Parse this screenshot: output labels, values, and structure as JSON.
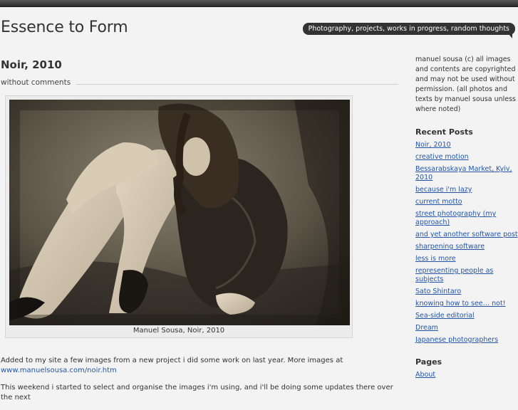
{
  "header": {
    "site_title": "Essence to Form",
    "tagline": "Photography, projects, works in progress, random thoughts"
  },
  "post": {
    "title": "Noir, 2010",
    "comments": "without comments",
    "caption": "Manuel Sousa, Noir, 2010",
    "paragraph1_text": "Added to my site a few images from a new project i did some work on last year. More images at",
    "paragraph1_link": "www.manuelsousa.com/noir.htm",
    "paragraph2_text": "This weekend i started to select and organise the images i'm using, and i'll be doing some updates there over the next"
  },
  "sidebar": {
    "about": "manuel sousa (c) all images and contents are copyrighted and may not be used without permission. (all photos and texts by manuel sousa unless where noted)",
    "recent_heading": "Recent Posts",
    "recent_posts": [
      "Noir, 2010",
      "creative motion",
      "Bessarabskaya Market, Kyiv, 2010",
      "because i'm lazy",
      "current motto",
      "street photography (my approach)",
      "and yet another software post",
      "sharpening software",
      "less is more",
      "representing people as subjects",
      "Sato Shintaro",
      "knowing how to see… not!",
      "Sea-side editorial",
      "Dream",
      "Japanese photographers"
    ],
    "pages_heading": "Pages",
    "pages": [
      "About"
    ]
  },
  "colors": {
    "link": "#2255aa",
    "tagline_bg": "#333333",
    "background": "#f3f3f3"
  }
}
